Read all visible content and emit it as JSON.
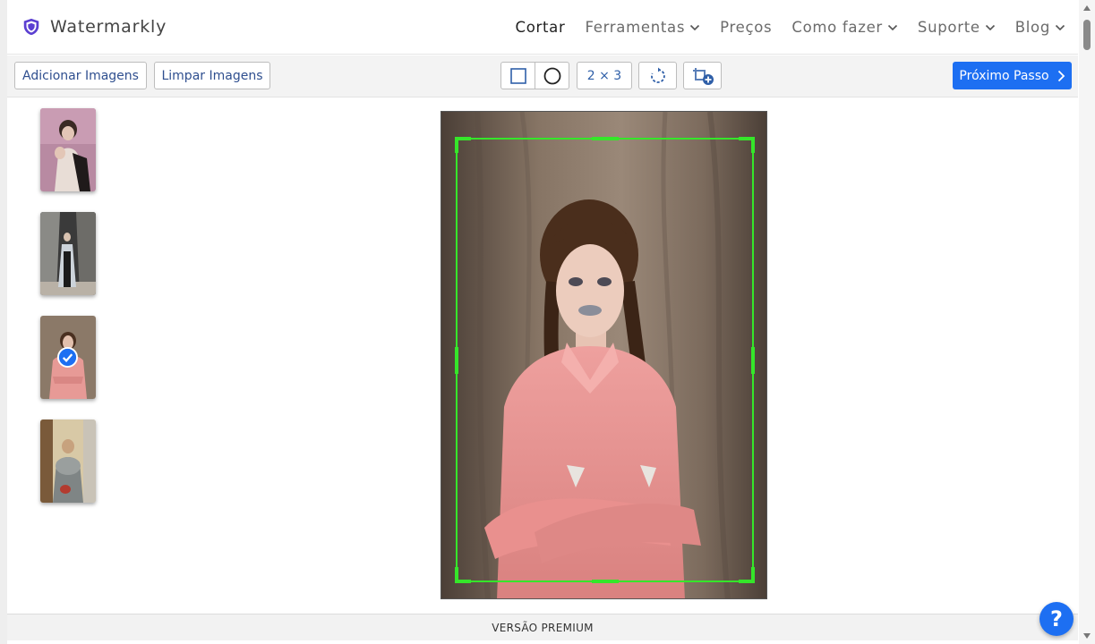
{
  "brand": {
    "name": "Watermarkly"
  },
  "nav": [
    {
      "label": "Cortar",
      "dropdown": false,
      "active": true
    },
    {
      "label": "Ferramentas",
      "dropdown": true,
      "active": false
    },
    {
      "label": "Preços",
      "dropdown": false,
      "active": false
    },
    {
      "label": "Como fazer",
      "dropdown": true,
      "active": false
    },
    {
      "label": "Suporte",
      "dropdown": true,
      "active": false
    },
    {
      "label": "Blog",
      "dropdown": true,
      "active": false
    }
  ],
  "toolbar": {
    "add_images": "Adicionar Imagens",
    "clear_images": "Limpar Imagens",
    "aspect_ratio": "2 × 3",
    "next_step": "Próximo Passo"
  },
  "thumbnails": [
    {
      "selected": false
    },
    {
      "selected": false
    },
    {
      "selected": true
    },
    {
      "selected": false
    }
  ],
  "footer": {
    "label": "VERSÃO PREMIUM"
  },
  "help": {
    "label": "?"
  },
  "colors": {
    "accent": "#1d6ff2",
    "crop_frame": "#35e62a",
    "brand_shield": "#5b3fd1"
  }
}
